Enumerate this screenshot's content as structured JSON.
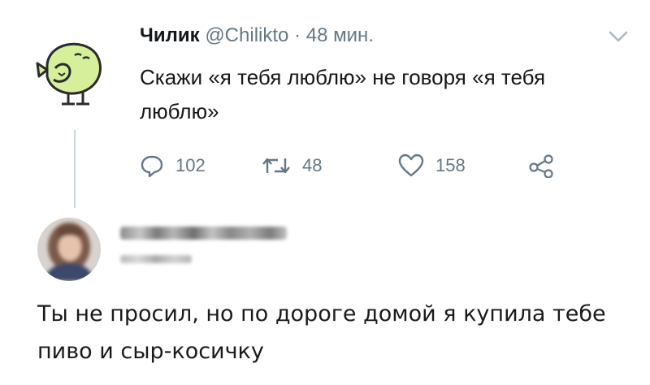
{
  "tweet": {
    "author_name": "Чилик",
    "author_handle": "@Chilikto",
    "separator": "·",
    "time": "48 мин.",
    "text": "Скажи «я тебя люблю» не говоря «я тебя люблю»",
    "reply_count": "102",
    "retweet_count": "48",
    "like_count": "158"
  },
  "reply": {
    "text": "Ты не просил, но по дороге домой я купила тебе пиво и сыр-косичку"
  },
  "icons": {
    "avatar": "bird-avatar-icon",
    "reply": "reply-icon",
    "retweet": "retweet-icon",
    "like": "heart-icon",
    "share": "share-icon",
    "more": "chevron-down-icon"
  },
  "colors": {
    "avatar_green": "#d6ef9a",
    "muted": "#657786",
    "text": "#14171a"
  }
}
